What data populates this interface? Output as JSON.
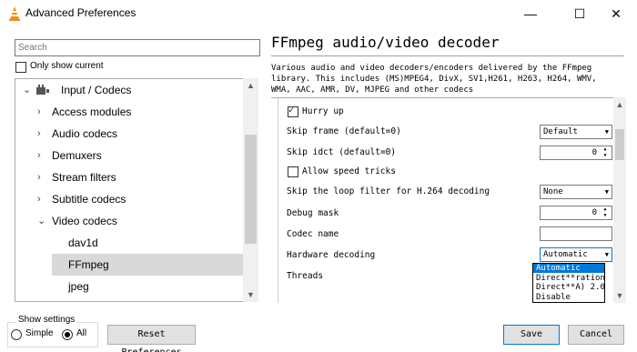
{
  "window": {
    "title": "Advanced Preferences",
    "icon": "vlc-cone-icon",
    "min_glyph": "—",
    "max_glyph": "☐",
    "close_glyph": "✕"
  },
  "left": {
    "search_placeholder": "Search",
    "only_show_current": "Only show current",
    "tree": [
      {
        "label": "Input / Codecs",
        "chevron": "⌄",
        "icon": "input-codecs-icon"
      },
      {
        "label": "Access modules",
        "chevron": "›"
      },
      {
        "label": "Audio codecs",
        "chevron": "›"
      },
      {
        "label": "Demuxers",
        "chevron": "›"
      },
      {
        "label": "Stream filters",
        "chevron": "›"
      },
      {
        "label": "Subtitle codecs",
        "chevron": "›"
      },
      {
        "label": "Video codecs",
        "chevron": "⌄"
      },
      {
        "label": "dav1d"
      },
      {
        "label": "FFmpeg",
        "selected": true
      },
      {
        "label": "jpeg"
      }
    ],
    "scroll_up": "▲",
    "scroll_down": "▼"
  },
  "bottom": {
    "show_settings": "Show settings",
    "simple": "Simple",
    "all": "All",
    "selected_mode": "All",
    "reset": "Reset Preferences",
    "save": "Save",
    "cancel": "Cancel"
  },
  "right": {
    "title": "FFmpeg audio/video decoder",
    "description": "Various audio and video decoders/encoders delivered by the FFmpeg library. This includes (MS)MPEG4, DivX, SV1,H261, H263, H264, WMV, WMA, AAC, AMR, DV, MJPEG and other codecs",
    "settings": {
      "hurry_up": "Hurry up",
      "hurry_up_checked": true,
      "skip_frame_label": "Skip frame (default=0)",
      "skip_frame_value": "Default",
      "skip_idct_label": "Skip idct (default=0)",
      "skip_idct_value": "0",
      "allow_speed_tricks": "Allow speed tricks",
      "allow_speed_tricks_checked": false,
      "skip_loop_label": "Skip the loop filter for H.264 decoding",
      "skip_loop_value": "None",
      "debug_mask_label": "Debug mask",
      "debug_mask_value": "0",
      "codec_name_label": "Codec name",
      "codec_name_value": "",
      "hw_decoding_label": "Hardware decoding",
      "hw_decoding_value": "Automatic",
      "threads_label": "Threads"
    },
    "hw_options": [
      "Automatic",
      "Direct**ration",
      "Direct**A) 2.0",
      "Disable"
    ],
    "check_glyph": "✓",
    "combo_arrow": "▼",
    "spin_up": "▲",
    "spin_down": "▼"
  }
}
